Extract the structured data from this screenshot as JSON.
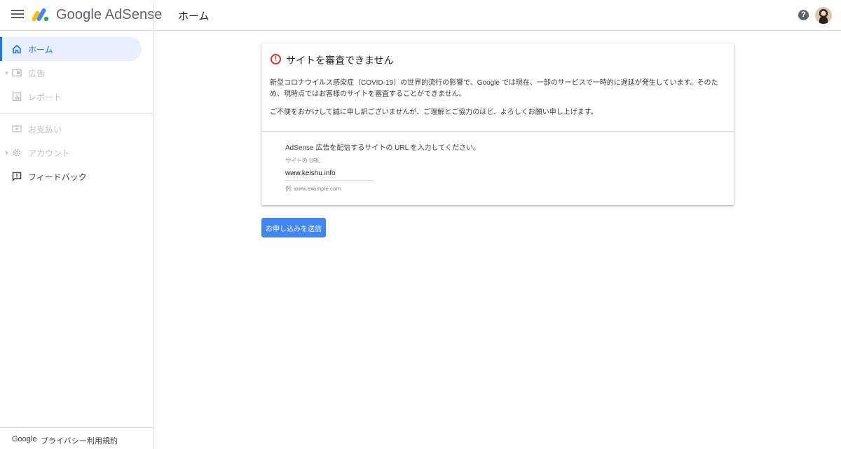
{
  "header": {
    "brand": "Google AdSense",
    "title": "ホーム",
    "help_symbol": "?"
  },
  "sidebar": {
    "items": [
      {
        "label": "ホーム",
        "icon": "home-icon",
        "state": "active"
      },
      {
        "label": "広告",
        "icon": "ads-icon",
        "state": "disabled"
      },
      {
        "label": "レポート",
        "icon": "report-icon",
        "state": "disabled"
      },
      {
        "label": "お支払い",
        "icon": "payments-icon",
        "state": "disabled"
      },
      {
        "label": "アカウント",
        "icon": "gear-icon",
        "state": "disabled"
      },
      {
        "label": "フィードバック",
        "icon": "feedback-icon",
        "state": "enabled"
      }
    ],
    "footer": {
      "google": "Google",
      "privacy": "プライバシー",
      "terms": "利用規約"
    }
  },
  "card": {
    "title": "サイトを審査できません",
    "alert_symbol": "!",
    "body1": "新型コロナウイルス感染症（COVID-19）の世界的流行の影響で、Google では現在、一部のサービスで一時的に遅延が発生しています。そのため、現時点ではお客様のサイトを審査することができません。",
    "body2": "ご不便をおかけして誠に申し訳ございませんが、ご理解とご協力のほど、よろしくお願い申し上げます。",
    "url_prompt": "AdSense 広告を配信するサイトの URL を入力してください。",
    "url_label": "サイトの URL",
    "url_value": "www.keishu.info",
    "url_hint": "例: www.example.com"
  },
  "submit_label": "お申し込みを送信",
  "colors": {
    "accent": "#1a73e8",
    "button": "#4285f4",
    "error": "#d93025",
    "active_bg": "#e8f0fe"
  }
}
